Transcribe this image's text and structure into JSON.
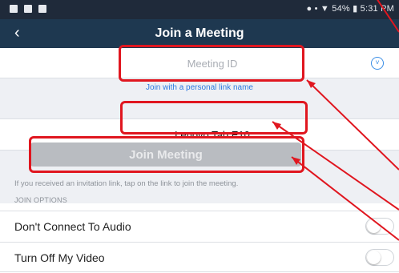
{
  "status_bar": {
    "right_text": "● • ▼ 54% ▮ 5:31 PM"
  },
  "nav": {
    "back_icon": "‹",
    "title": "Join a Meeting"
  },
  "meeting_id": {
    "placeholder": "Meeting ID",
    "value": "",
    "dropdown_icon": "˅"
  },
  "personal_link": {
    "label": "Join with a personal link name"
  },
  "name_field": {
    "value": "Lenovo Tab E10"
  },
  "join_button": {
    "label": "Join Meeting",
    "enabled": false
  },
  "hint": {
    "text": "If you received an invitation link, tap on the link to join the meeting."
  },
  "join_options": {
    "header": "JOIN OPTIONS",
    "items": [
      {
        "label": "Don't Connect To Audio",
        "on": false
      },
      {
        "label": "Turn Off My Video",
        "on": false
      }
    ]
  },
  "colors": {
    "status_bar": "#1f2a3a",
    "nav_bar": "#1e3850",
    "link": "#2d7be0",
    "button_disabled": "#b9bcc1",
    "annotation": "#e0161f"
  }
}
